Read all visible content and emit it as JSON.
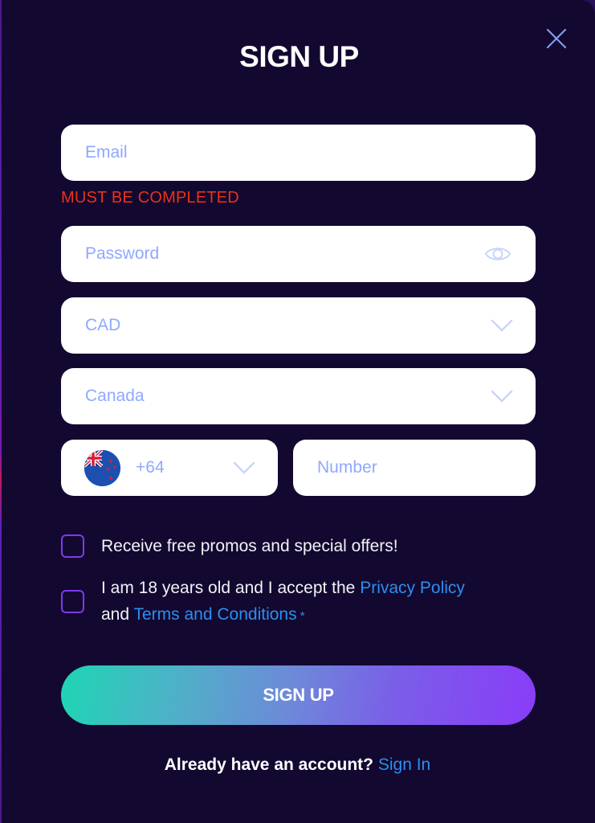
{
  "modal": {
    "title": "SIGN UP",
    "close_icon": "close-icon"
  },
  "form": {
    "email": {
      "placeholder": "Email",
      "value": ""
    },
    "email_error": "MUST BE COMPLETED",
    "password": {
      "placeholder": "Password",
      "value": "",
      "toggle_icon": "eye-icon"
    },
    "currency": {
      "selected": "CAD",
      "icon": "chevron-down-icon"
    },
    "country": {
      "selected": "Canada",
      "icon": "chevron-down-icon"
    },
    "phone_code": {
      "selected": "+64",
      "flag": "new-zealand-flag",
      "icon": "chevron-down-icon"
    },
    "phone_number": {
      "placeholder": "Number",
      "value": ""
    }
  },
  "checkboxes": {
    "promos": {
      "label": "Receive free promos and special offers!",
      "checked": false
    },
    "terms": {
      "text_prefix": "I am 18 years old and I accept the ",
      "privacy_link": "Privacy Policy",
      "text_and": "and ",
      "terms_link": "Terms and Conditions",
      "required_mark": " *",
      "checked": false
    }
  },
  "submit": {
    "label": "SIGN UP"
  },
  "footer": {
    "prompt": "Already have an account? ",
    "sign_in_link": "Sign In"
  },
  "colors": {
    "background": "#130830",
    "error": "#e8331a",
    "link": "#2a8ff0",
    "placeholder": "#8fa8ff",
    "checkbox_border": "#7c3aed",
    "gradient_start": "#1ed6b4",
    "gradient_end": "#8a3cf8"
  }
}
